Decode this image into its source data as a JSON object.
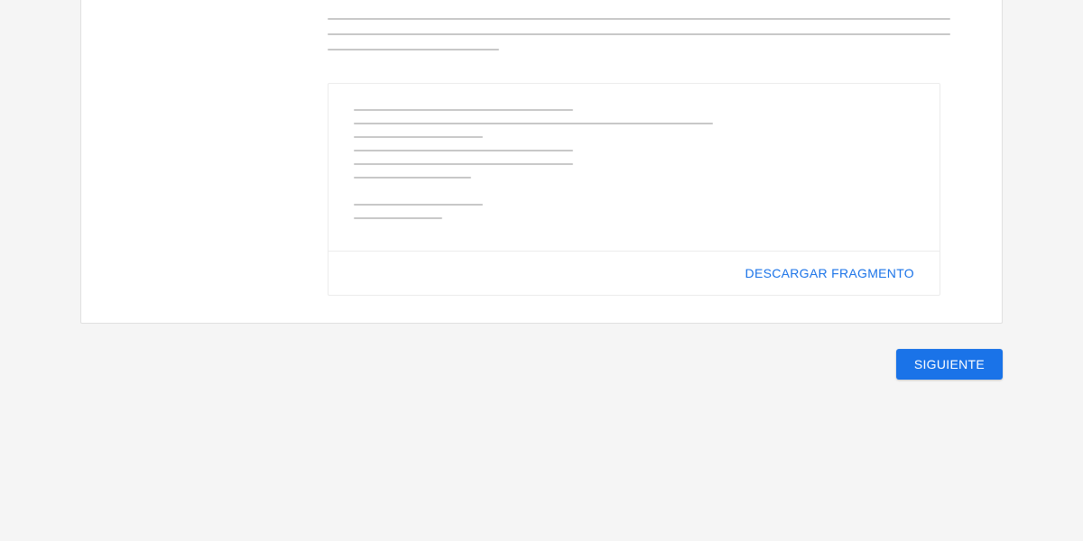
{
  "description": {
    "placeholder_lines": [
      690,
      690,
      190
    ]
  },
  "snippet": {
    "placeholder_lines": [
      243,
      398,
      143,
      243,
      243,
      130,
      0,
      143,
      98
    ],
    "download_label": "DESCARGAR FRAGMENTO"
  },
  "actions": {
    "next_label": "SIGUIENTE"
  }
}
